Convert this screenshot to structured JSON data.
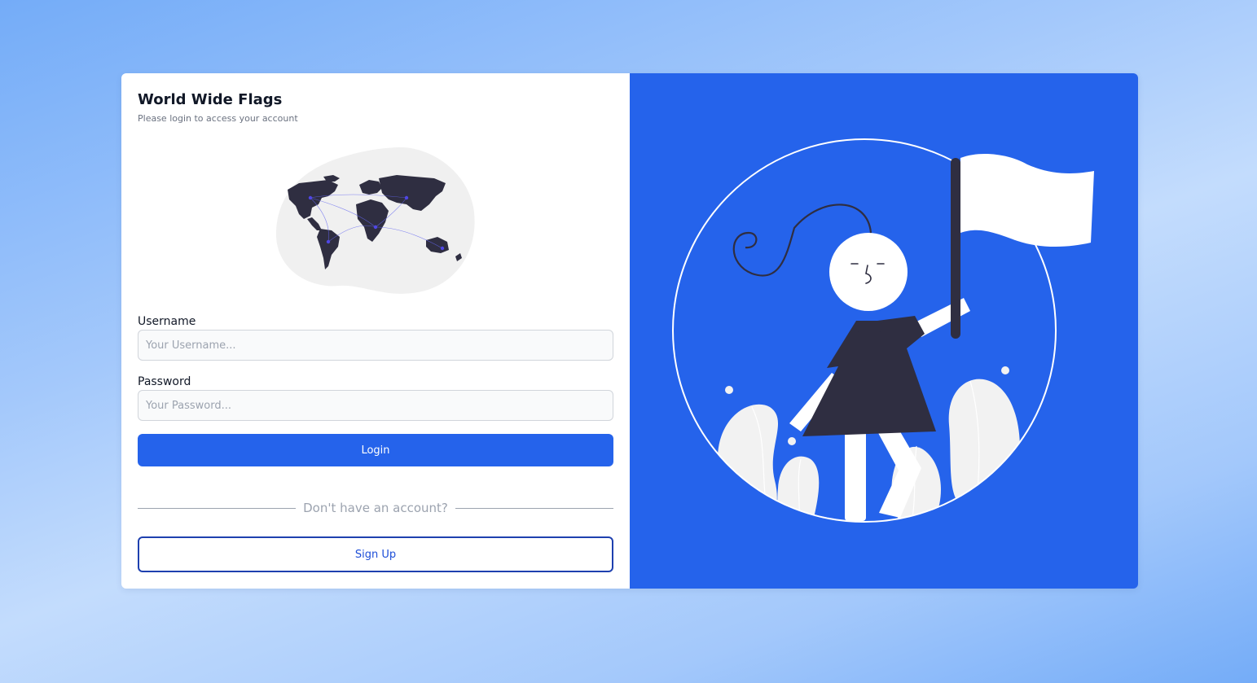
{
  "app": {
    "title": "World Wide Flags",
    "subtitle": "Please login to access your account"
  },
  "form": {
    "username_label": "Username",
    "username_placeholder": "Your Username...",
    "username_value": "",
    "password_label": "Password",
    "password_placeholder": "Your Password...",
    "password_value": "",
    "login_label": "Login"
  },
  "signup": {
    "prompt": "Don't have an account?",
    "button_label": "Sign Up"
  },
  "illustrations": {
    "left": "world-map-illustration",
    "right": "person-with-flag-illustration"
  },
  "colors": {
    "primary": "#2563eb",
    "signup_border": "#1e40af",
    "dark_figure": "#2f2e41"
  }
}
